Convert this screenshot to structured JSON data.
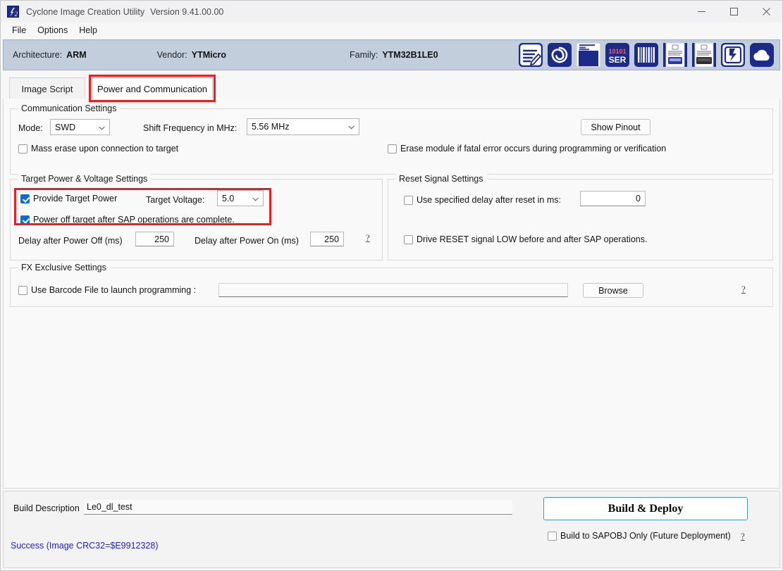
{
  "window": {
    "title": "Cyclone Image Creation Utility",
    "version": "Version 9.41.00.00",
    "app_icon": "cyclone-logo-icon",
    "minimize_label": "minimize-icon",
    "maximize_label": "maximize-icon",
    "close_label": "close-icon"
  },
  "menu": {
    "items": [
      {
        "label": "File"
      },
      {
        "label": "Options"
      },
      {
        "label": "Help"
      }
    ]
  },
  "infobar": {
    "architecture_label": "Architecture:",
    "architecture_value": "ARM",
    "vendor_label": "Vendor:",
    "vendor_value": "YTMicro",
    "family_label": "Family:",
    "family_value": "YTM32B1LE0",
    "toolbar_icons": [
      "edit-script-icon",
      "spiral-icon",
      "license-manager-icon",
      "serial-numbers-icon",
      "barcode-icon",
      "cyclone-device-1-icon",
      "cyclone-device-2-icon",
      "pemicro-flash-icon",
      "cloud-icon"
    ]
  },
  "tabs": [
    {
      "label": "Image Script",
      "active": false
    },
    {
      "label": "Power and Communication",
      "active": true
    }
  ],
  "communication": {
    "group_title": "Communication Settings",
    "mode_label": "Mode:",
    "mode_value": "SWD",
    "shift_freq_label": "Shift Frequency in MHz:",
    "shift_freq_value": "5.56 MHz",
    "show_pinout_label": "Show Pinout",
    "mass_erase_label": "Mass erase upon connection to target",
    "mass_erase_checked": false,
    "erase_module_label": "Erase module if fatal error occurs during programming or verification",
    "erase_module_checked": false
  },
  "power": {
    "group_title": "Target Power & Voltage Settings",
    "provide_power_label": "Provide Target Power",
    "provide_power_checked": true,
    "target_voltage_label": "Target Voltage:",
    "target_voltage_value": "5.0",
    "power_off_label": "Power off target after SAP operations are complete.",
    "power_off_checked": true,
    "delay_off_label": "Delay after Power Off (ms)",
    "delay_off_value": "250",
    "delay_on_label": "Delay after Power On (ms)",
    "delay_on_value": "250",
    "help_label": "?"
  },
  "reset": {
    "group_title": "Reset Signal Settings",
    "use_delay_label": "Use specified delay after reset in ms:",
    "use_delay_checked": false,
    "delay_value": "0",
    "drive_reset_label": "Drive RESET signal LOW before and after SAP operations.",
    "drive_reset_checked": false
  },
  "fx": {
    "group_title": "FX Exclusive Settings",
    "barcode_label": "Use Barcode File to launch programming :",
    "barcode_checked": false,
    "barcode_path": "",
    "browse_label": "Browse",
    "help_label": "?"
  },
  "footer": {
    "build_desc_label": "Build Description",
    "build_desc_value": "Le0_dl_test",
    "status_text": "Success (Image CRC32=$E9912328)",
    "deploy_label": "Build & Deploy",
    "sapobj_label": "Build to SAPOBJ Only (Future Deployment)",
    "sapobj_checked": false,
    "help_label": "?"
  },
  "colors": {
    "accent_blue": "#1c2a8a",
    "highlight_red": "#ee1c23",
    "status_blue": "#2222cc",
    "infobar_bg": "#c3cedd",
    "checkbox_checked": "#0a6ed1"
  }
}
